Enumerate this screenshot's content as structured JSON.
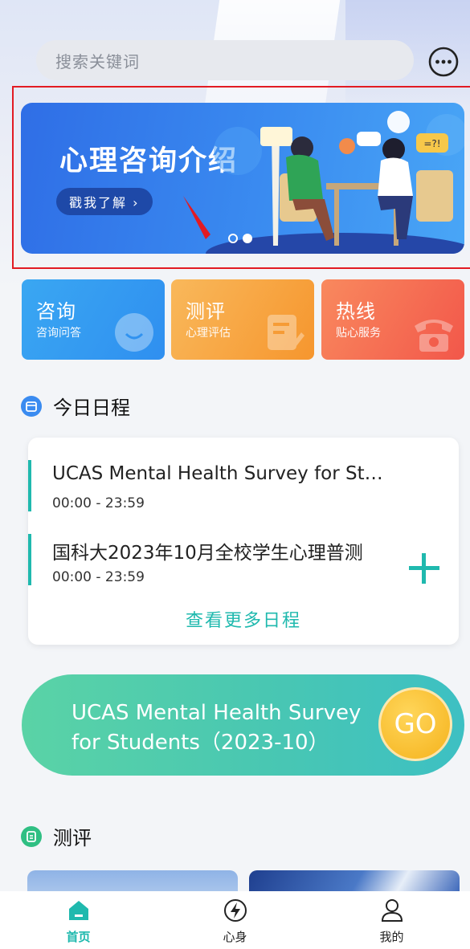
{
  "search": {
    "placeholder": "搜索关键词"
  },
  "banner": {
    "title": "心理咨询介绍",
    "button_label": "戳我了解 ›",
    "bubble_text": "=?!"
  },
  "categories": [
    {
      "title": "咨询",
      "subtitle": "咨询问答",
      "icon": "chat-bubble-icon"
    },
    {
      "title": "测评",
      "subtitle": "心理评估",
      "icon": "clipboard-icon"
    },
    {
      "title": "热线",
      "subtitle": "贴心服务",
      "icon": "telephone-icon"
    }
  ],
  "schedule": {
    "section_title": "今日日程",
    "items": [
      {
        "name": "UCAS Mental Health Survey for St…",
        "time": "00:00 - 23:59"
      },
      {
        "name": "国科大2023年10月全校学生心理普测",
        "time": "00:00 - 23:59"
      }
    ],
    "more_label": "查看更多日程"
  },
  "survey": {
    "title": "UCAS Mental Health Survey for Students（2023-10）",
    "go_label": "GO"
  },
  "assessment": {
    "section_title": "测评"
  },
  "tabbar": [
    {
      "label": "首页",
      "active": true
    },
    {
      "label": "心身",
      "active": false
    },
    {
      "label": "我的",
      "active": false
    }
  ],
  "colors": {
    "accent": "#1fb9ae",
    "highlight_border": "#e21b23"
  }
}
